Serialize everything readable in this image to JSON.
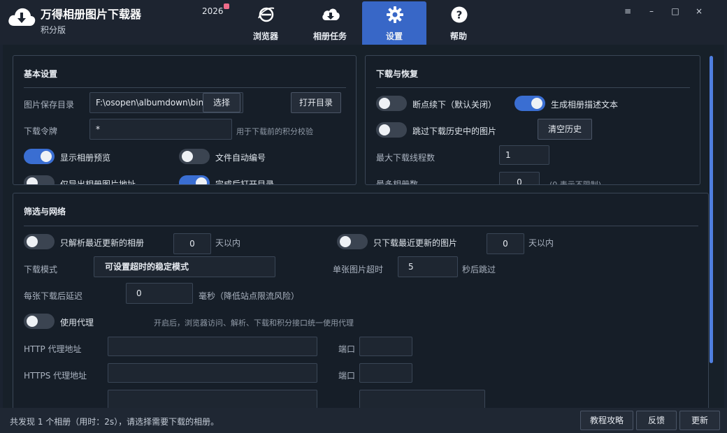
{
  "app": {
    "title": "万得相册图片下载器",
    "subtitle": "积分版",
    "year": "2026"
  },
  "nav": {
    "tabs": [
      {
        "label": "浏览器",
        "icon": "browser-e-icon"
      },
      {
        "label": "相册任务",
        "icon": "cloud-download-icon"
      },
      {
        "label": "设置",
        "icon": "gear-icon",
        "active": true
      },
      {
        "label": "帮助",
        "icon": "help-circle-icon"
      }
    ]
  },
  "window_controls": {
    "menu": "≡",
    "minimize": "–",
    "maximize": "□",
    "close": "×"
  },
  "basic": {
    "title": "基本设置",
    "save_dir_label": "图片保存目录",
    "save_dir_value": "F:\\osopen\\albumdown\\bin\\",
    "choose_btn": "选择",
    "open_dir_btn": "打开目录",
    "token_label": "下载令牌",
    "token_value": "*",
    "token_hint": "用于下载前的积分校验",
    "show_preview": {
      "label": "显示相册预览",
      "on": true
    },
    "auto_number": {
      "label": "文件自动编号",
      "on": false
    },
    "only_export": {
      "label": "仅导出相册图片地址",
      "on": false
    },
    "open_after": {
      "label": "完成后打开目录",
      "on": true
    }
  },
  "download": {
    "title": "下载与恢复",
    "resume": {
      "label": "断点续下（默认关闭）",
      "on": false
    },
    "gen_desc": {
      "label": "生成相册描述文本",
      "on": true
    },
    "skip_history": {
      "label": "跳过下载历史中的图片",
      "on": false
    },
    "clear_history_btn": "清空历史",
    "max_threads_label": "最大下载线程数",
    "max_threads_value": "1",
    "max_albums_label": "最多相册数",
    "max_albums_value": "0",
    "max_albums_hint": "(0 表示不限制)"
  },
  "filter": {
    "title": "筛选与网络",
    "recent_albums": {
      "label": "只解析最近更新的相册",
      "on": false,
      "value": "0",
      "unit": "天以内"
    },
    "recent_images": {
      "label": "只下载最近更新的图片",
      "on": false,
      "value": "0",
      "unit": "天以内"
    },
    "mode_label": "下载模式",
    "mode_value": "可设置超时的稳定模式",
    "timeout_label": "单张图片超时",
    "timeout_value": "5",
    "timeout_unit": "秒后跳过",
    "delay_label": "每张下载后延迟",
    "delay_value": "0",
    "delay_unit": "毫秒（降低站点限流风险）",
    "proxy": {
      "label": "使用代理",
      "on": false,
      "hint": "开启后，浏览器访问、解析、下载和积分接口统一使用代理"
    },
    "http_proxy_label": "HTTP 代理地址",
    "http_proxy_value": "",
    "http_port_label": "端口",
    "http_port_value": "",
    "https_proxy_label": "HTTPS 代理地址",
    "https_proxy_value": "",
    "https_port_label": "端口",
    "https_port_value": ""
  },
  "status": {
    "text": "共发现 1 个相册（用时：2s），请选择需要下载的相册。",
    "buttons": [
      "教程攻略",
      "反馈",
      "更新"
    ]
  },
  "colors": {
    "accent": "#3867c7",
    "toggle_on": "#3a6ed2",
    "background": "#172029"
  }
}
